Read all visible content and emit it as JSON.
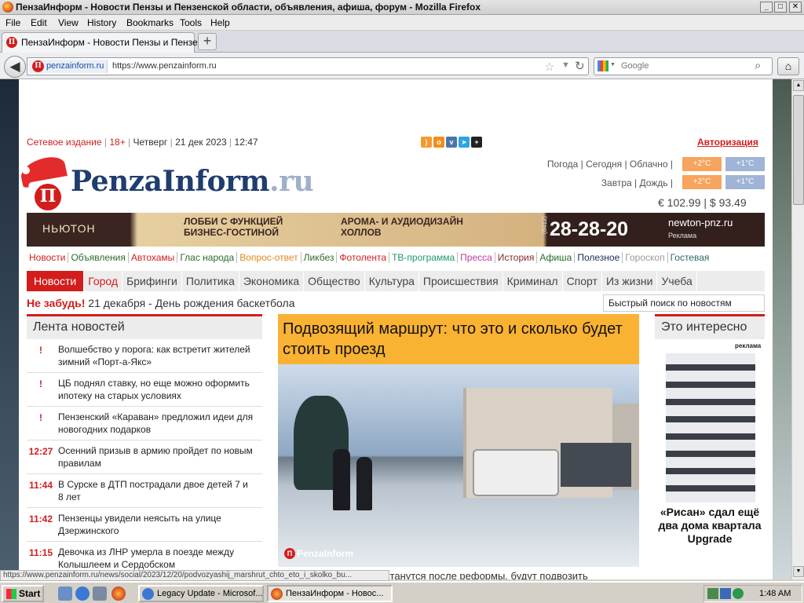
{
  "window": {
    "title": "ПензаИнформ - Новости Пензы и Пензенской области, объявления, афиша, форум - Mozilla Firefox",
    "controls": [
      "_",
      "□",
      "✕"
    ]
  },
  "menu": [
    "File",
    "Edit",
    "View",
    "History",
    "Bookmarks",
    "Tools",
    "Help"
  ],
  "tab": {
    "title": "ПензаИнформ - Новости Пензы и Пензенс...",
    "new_tab": "+"
  },
  "nav": {
    "site_identity": "penzainform.ru",
    "url": "https://www.penzainform.ru",
    "search_placeholder": "Google"
  },
  "site": {
    "topline": {
      "edition": "Сетевое издание",
      "age": "18+",
      "weekday": "Четверг",
      "date": "21 дек 2023",
      "time": "12:47",
      "auth": "Авторизация"
    },
    "social_icons": [
      "rss-icon",
      "ok-icon",
      "vk-icon",
      "telegram-icon",
      "plus-icon"
    ],
    "logo": {
      "main": "PenzaInform",
      "tld": ".ru",
      "icon_letter": "Π"
    },
    "weather": {
      "today": "Погода | Сегодня | Облачно |",
      "today_temps": [
        "+2°C",
        "+1°C"
      ],
      "tomorrow": "Завтра | Дождь |",
      "tomorrow_temps": [
        "+2°C",
        "+1°C"
      ],
      "currency": "€ 102.99 | $ 93.49"
    },
    "banner": {
      "brand": "НЬЮТОН",
      "left_text": "ЛОББИ С ФУНКЦИЕЙ БИЗНЕС-ГОСТИНОЙ",
      "mid_text": "АРОМА- И АУДИОДИЗАЙН ХОЛЛОВ",
      "phone_code": "(8412)",
      "phone": "28-28-20",
      "site": "newton-pnz.ru",
      "ad_label": "Реклама"
    },
    "nav1": [
      {
        "label": "Новости",
        "color": "#d31d1d"
      },
      {
        "label": "Объявления",
        "color": "#2a6a2a"
      },
      {
        "label": "Автохамы",
        "color": "#d31d1d"
      },
      {
        "label": "Глас народа",
        "color": "#2a6a2a"
      },
      {
        "label": "Вопрос-ответ",
        "color": "#e08a1e"
      },
      {
        "label": "Ликбез",
        "color": "#2a6a2a"
      },
      {
        "label": "Фотолента",
        "color": "#d31d1d"
      },
      {
        "label": "ТВ-программа",
        "color": "#1e9a6a"
      },
      {
        "label": "Пресса",
        "color": "#c03aa0"
      },
      {
        "label": "История",
        "color": "#8a2a2a"
      },
      {
        "label": "Афиша",
        "color": "#2a6a2a"
      },
      {
        "label": "Полезное",
        "color": "#1a2a5a"
      },
      {
        "label": "Гороскоп",
        "color": "#999999"
      },
      {
        "label": "Гостевая",
        "color": "#2a6a6a"
      }
    ],
    "nav2": [
      "Новости",
      "Город",
      "Брифинги",
      "Политика",
      "Экономика",
      "Общество",
      "Культура",
      "Происшествия",
      "Криминал",
      "Спорт",
      "Из жизни",
      "Учеба"
    ],
    "reminder": {
      "label": "Не забудь!",
      "text": "21 декабря - День рождения баскетбола"
    },
    "quick_search": "Быстрый поиск по новостям",
    "feed": {
      "title": "Лента новостей",
      "items": [
        {
          "time": "!",
          "text": "Волшебство у порога: как встретит жителей зимний «Порт-а-Якс»"
        },
        {
          "time": "!",
          "text": "ЦБ поднял ставку, но еще можно оформить ипотеку на старых условиях"
        },
        {
          "time": "!",
          "text": "Пензенский «Караван» предложил идеи для новогодних подарков"
        },
        {
          "time": "12:27",
          "text": "Осенний призыв в армию пройдет по новым правилам"
        },
        {
          "time": "11:44",
          "text": "В Сурске в ДТП пострадали двое детей 7 и 8 лет"
        },
        {
          "time": "11:42",
          "text": "Пензенцы увидели неясыть на улице Дзержинского"
        },
        {
          "time": "11:15",
          "text": "Девочка из ЛНР умерла в поезде между Колышлеем и Сердобском"
        }
      ]
    },
    "main": {
      "headline": "Подвозящий маршрут: что это и сколько будет стоить проезд",
      "watermark": "PenzaInform",
      "below": "Маршрутки, которые останутся после реформы, будут подвозить"
    },
    "right": {
      "title": "Это интересно",
      "ad_label": "реклама",
      "ad_text": "«Рисан» сдал ещё два дома квартала Upgrade"
    }
  },
  "status_text": "https://www.penzainform.ru/news/social/2023/12/20/podvozyashij_marshrut_chto_eto_i_skolko_bu...",
  "taskbar": {
    "start": "Start",
    "tasks": [
      "Legacy Update - Microsof...",
      "ПензаИнформ - Новос..."
    ],
    "clock": "1:48 AM"
  }
}
